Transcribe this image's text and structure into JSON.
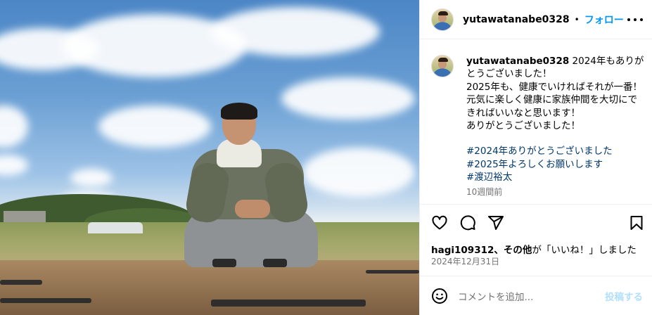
{
  "post": {
    "username": "yutawatanabe0328",
    "dot": "•",
    "follow_label": "フォロー"
  },
  "caption": {
    "username": "yutawatanabe0328",
    "lines": [
      "2024年もありがとうございました！",
      "2025年も、健康でいければそれが一番！",
      "元気に楽しく健康に家族仲間を大切にできればいいなと思います！",
      "ありがとうございました！"
    ],
    "hashtags": [
      "#2024年ありがとうございました",
      "#2025年よろしくお願いします",
      "#渡辺裕太"
    ],
    "time_ago": "10週間前"
  },
  "engagement": {
    "liked_by_user": "hagi109312",
    "liked_by_suffix": "、その他",
    "liked_by_tail": "が「いいね！」しました",
    "date": "2024年12月31日"
  },
  "comment": {
    "placeholder": "コメントを追加...",
    "post_label": "投稿する"
  },
  "icons": [
    "heart-icon",
    "comment-icon",
    "share-icon",
    "bookmark-icon",
    "more-icon",
    "emoji-icon"
  ],
  "colors": {
    "accent": "#0095f6",
    "hashtag": "#00376b",
    "muted": "#737373",
    "post_disabled": "#b2dffc"
  }
}
